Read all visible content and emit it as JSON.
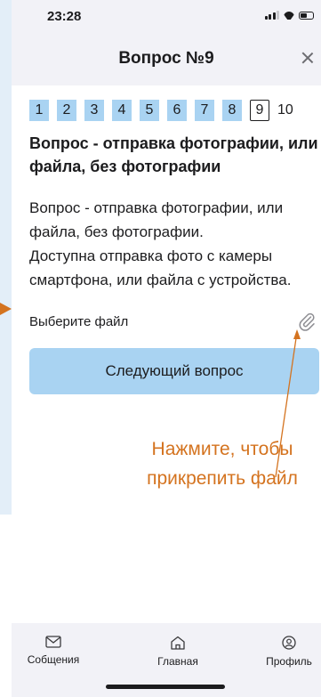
{
  "status_bar": {
    "time": "23:28"
  },
  "header": {
    "title": "Вопрос №9"
  },
  "question_numbers": [
    "1",
    "2",
    "3",
    "4",
    "5",
    "6",
    "7",
    "8",
    "9",
    "10"
  ],
  "active_question": "9",
  "question": {
    "title": "Вопрос - отправка фотографии, или файла, без фотографии",
    "text_line1": "Вопрос - отправка фотографии, или файла, без фотографии.",
    "text_line2": "Доступна отправка фото с камеры смартфона, или файла с устройства."
  },
  "file_picker": {
    "label": "Выберите файл",
    "icon": "paperclip-icon"
  },
  "next_button": {
    "label": "Следующий вопрос"
  },
  "annotation": {
    "text": "Нажмите, чтобы прикрепить файл",
    "color": "#d4731f"
  },
  "tabbar": {
    "messages": "Собщения",
    "home": "Главная",
    "profile": "Профиль"
  },
  "colors": {
    "accent": "#a9d3f2",
    "bar_bg": "#f2f2f7",
    "annotation": "#d4731f"
  }
}
